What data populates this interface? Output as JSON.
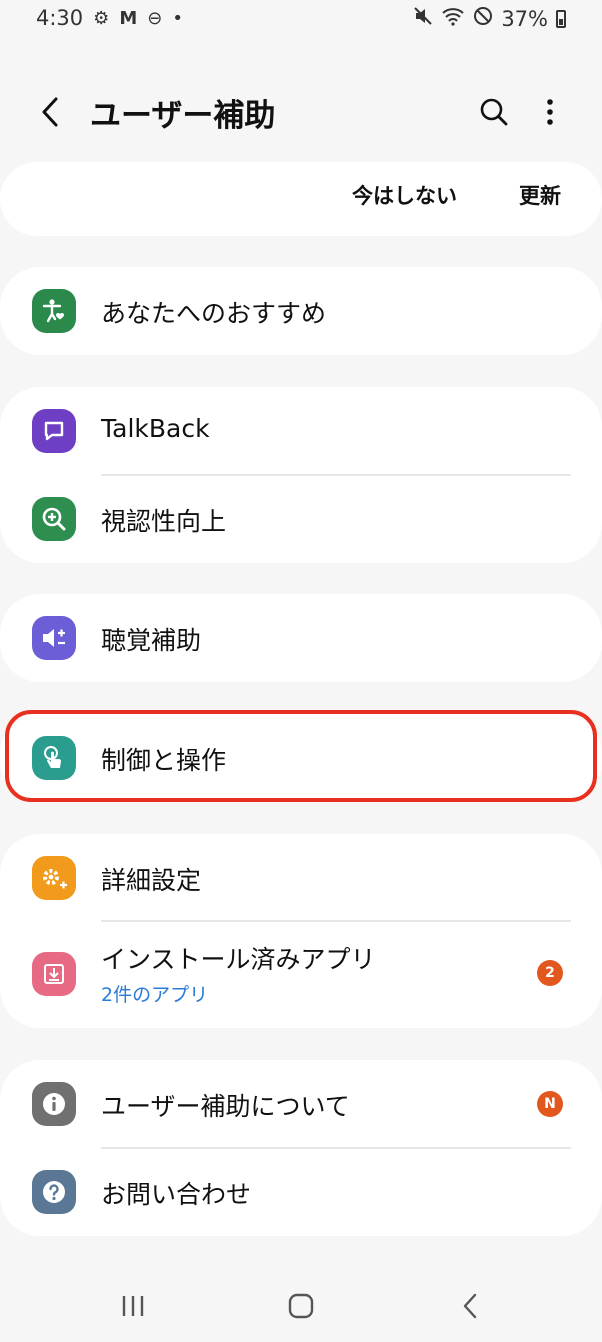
{
  "status_bar": {
    "time": "4:30",
    "left_icons": [
      "gear-icon",
      "gmail-icon",
      "do-not-disturb-icon",
      "dot-icon"
    ],
    "battery": "37%",
    "right_icons": [
      "mute-icon",
      "wifi-icon",
      "blocked-icon",
      "battery-icon"
    ]
  },
  "app_bar": {
    "title": "ユーザー補助"
  },
  "update_banner": {
    "not_now_label": "今はしない",
    "update_label": "更新"
  },
  "sections": {
    "recommended": {
      "label": "あなたへのおすすめ",
      "icon": "accessibility-heart-icon",
      "color": "#2b8a4b"
    },
    "talkback": {
      "label": "TalkBack",
      "icon": "talkback-icon",
      "color": "#6e3fc4"
    },
    "visibility": {
      "label": "視認性向上",
      "icon": "zoom-in-icon",
      "color": "#2e8e4f"
    },
    "hearing": {
      "label": "聴覚補助",
      "icon": "volume-icon",
      "color": "#6b5ed6"
    },
    "interaction": {
      "label": "制御と操作",
      "icon": "touch-icon",
      "color": "#2a9d8f"
    },
    "advanced": {
      "label": "詳細設定",
      "icon": "gear-plus-icon",
      "color": "#f29a1b"
    },
    "installed": {
      "label": "インストール済みアプリ",
      "sub": "2件のアプリ",
      "badge": "2",
      "icon": "download-icon",
      "color": "#e76a84"
    },
    "about": {
      "label": "ユーザー補助について",
      "badge": "N",
      "icon": "info-icon",
      "color": "#707070"
    },
    "contact": {
      "label": "お問い合わせ",
      "icon": "help-icon",
      "color": "#5a7896"
    }
  },
  "nav_bar": {
    "icons": [
      "recent-apps-icon",
      "home-icon",
      "back-icon"
    ]
  }
}
